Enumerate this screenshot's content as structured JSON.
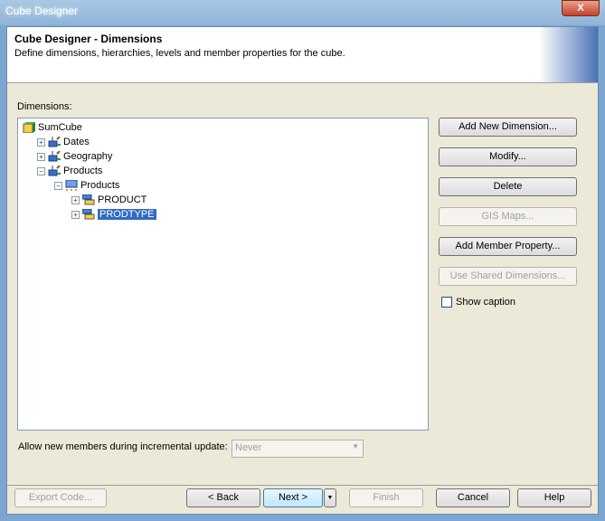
{
  "window": {
    "title": "Cube Designer",
    "close": "X"
  },
  "header": {
    "title": "Cube Designer - Dimensions",
    "subtitle": "Define dimensions, hierarchies, levels and member properties for the cube."
  },
  "dimensions_label": "Dimensions:",
  "tree": [
    {
      "label": "SumCube",
      "icon": "cube-icon",
      "level": 0,
      "expander": ""
    },
    {
      "label": "Dates",
      "icon": "dimension-icon",
      "level": 1,
      "expander": "+"
    },
    {
      "label": "Geography",
      "icon": "dimension-icon",
      "level": 1,
      "expander": "+"
    },
    {
      "label": "Products",
      "icon": "dimension-icon",
      "level": 1,
      "expander": "-"
    },
    {
      "label": "Products",
      "icon": "hierarchy-icon",
      "level": 2,
      "expander": "-"
    },
    {
      "label": "PRODUCT",
      "icon": "level-icon",
      "level": 3,
      "expander": "+"
    },
    {
      "label": "PRODTYPE",
      "icon": "level-icon",
      "level": 3,
      "expander": "+",
      "selected": true
    }
  ],
  "buttons": {
    "add_dimension": "Add New Dimension...",
    "modify": "Modify...",
    "delete": "Delete",
    "gis_maps": "GIS Maps...",
    "add_member_property": "Add Member Property...",
    "use_shared": "Use Shared Dimensions..."
  },
  "show_caption": {
    "label": "Show caption",
    "checked": false
  },
  "allow_new": {
    "label": "Allow new members during incremental update:",
    "value": "Never"
  },
  "footer": {
    "export": "Export Code...",
    "back": "< Back",
    "next": "Next >",
    "finish": "Finish",
    "cancel": "Cancel",
    "help": "Help"
  },
  "colors": {
    "selection": "#316ac5",
    "background": "#ece9d8"
  }
}
